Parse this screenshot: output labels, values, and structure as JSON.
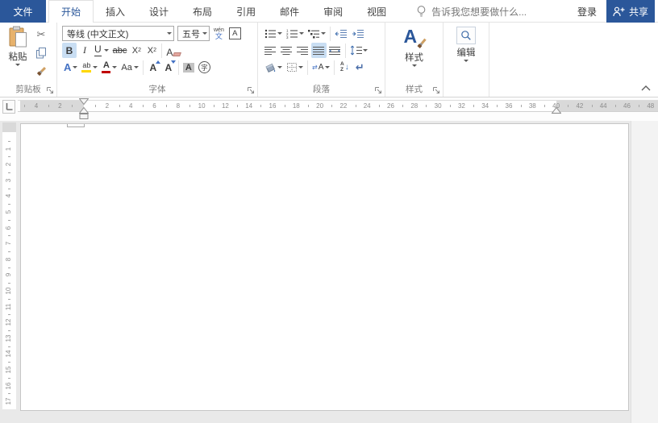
{
  "colors": {
    "accent": "#2b579a",
    "active_button_highlight": "#c9def3",
    "font_color_bar": "#c00000",
    "highlight_bar": "#ffd800"
  },
  "icons": {
    "cut": "✂",
    "pilcrow": "↵",
    "swap": "⇄",
    "sort_arrow": "↓"
  },
  "menubar": {
    "file_tab": "文件",
    "tabs": [
      "开始",
      "插入",
      "设计",
      "布局",
      "引用",
      "邮件",
      "审阅",
      "视图"
    ],
    "tellme_text": "告诉我您想要做什么...",
    "signin": "登录",
    "share": "共享"
  },
  "ribbon": {
    "clipboard": {
      "label": "剪贴板",
      "paste": "粘贴"
    },
    "font": {
      "label": "字体",
      "name": "等线 (中文正文)",
      "size": "五号",
      "bold": "B",
      "italic": "I",
      "underline": "U",
      "strikethrough": "abc",
      "sub_base": "X",
      "sub_digit": "2",
      "sup_base": "X",
      "sup_digit": "2",
      "phonetic_top": "wén",
      "phonetic_main": "文",
      "char_border": "A",
      "clear_format": "A",
      "text_effects": "A",
      "highlight": "ab",
      "font_color": "A",
      "change_case": "Aa",
      "grow_font": "A",
      "shrink_font": "A",
      "char_shading": "A",
      "enclose": "字"
    },
    "paragraph": {
      "label": "段落",
      "sort_a": "A",
      "sort_z": "Z",
      "asian_a": "A"
    },
    "styles": {
      "label": "样式",
      "button": "样式",
      "glyph": "A"
    },
    "editing": {
      "button": "编辑"
    }
  },
  "ruler": {
    "h_left_numbers": [
      "4",
      "2"
    ],
    "h_mid_numbers": [
      "2",
      "4",
      "6",
      "8",
      "10",
      "12",
      "14",
      "16",
      "18",
      "20",
      "22",
      "24",
      "26",
      "28",
      "30",
      "32",
      "34",
      "36",
      "38"
    ],
    "h_right_numbers": [
      "40",
      "42",
      "44",
      "46",
      "48"
    ],
    "v_numbers": [
      "1",
      "2",
      "3",
      "4",
      "5",
      "6",
      "7",
      "8",
      "9",
      "10",
      "11",
      "12",
      "13",
      "14",
      "15",
      "16",
      "17"
    ]
  },
  "document": {
    "page_color": "#ffffff",
    "workspace_color": "#e9e9e9"
  }
}
